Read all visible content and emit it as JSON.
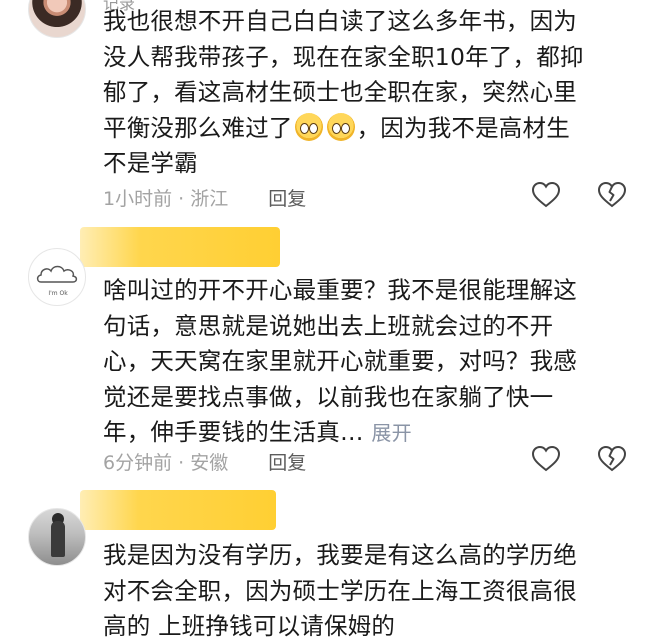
{
  "comments": [
    {
      "username": "记录",
      "lines": [
        "我也很想不开自己白白读了这么多年书，因为",
        "没人帮我带孩子，现在在家全职10年了，都抑",
        "郁了，看这高材生硕士也全职在家，突然心里",
        "平衡没那么难过了",
        "，因为我不是高材生",
        "不是学霸"
      ],
      "time_location": "1小时前 · 浙江",
      "reply_label": "回复",
      "emoji_name": "pleading-face-emoji"
    },
    {
      "lines": [
        "啥叫过的开不开心最重要？我不是很能理解这",
        "句话，意思就是说她出去上班就会过的不开",
        "心，天天窝在家里就开心就重要，对吗？我感",
        "觉还是要找点事做，以前我也在家躺了快一",
        "年，伸手要钱的生活真…"
      ],
      "expand_label": "展开",
      "time_location": "6分钟前 · 安徽",
      "reply_label": "回复",
      "avatar_text": "I'm Ok"
    },
    {
      "lines": [
        "我是因为没有学历，我要是有这么高的学历绝",
        "对不会全职，因为硕士学历在上海工资很高很",
        "高的 上班挣钱可以请保姆的"
      ]
    }
  ],
  "icons": {
    "like": "heart-outline-icon",
    "dislike": "broken-heart-icon"
  },
  "colors": {
    "text": "#1a1a1a",
    "meta": "#a3a3a3",
    "reply": "#5c5c5c",
    "expand": "#8a94a6",
    "highlight": "#ffd64d"
  }
}
